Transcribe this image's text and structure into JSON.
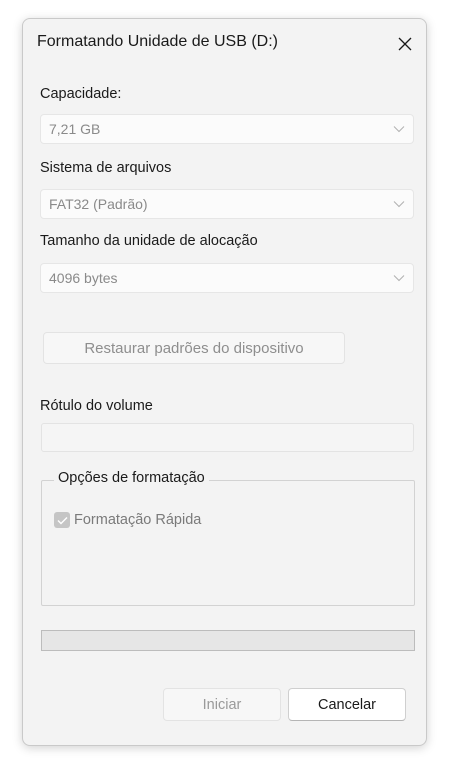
{
  "dialog": {
    "title": "Formatando Unidade de USB (D:)"
  },
  "capacity": {
    "label": "Capacidade:",
    "value": "7,21 GB"
  },
  "file_system": {
    "label": "Sistema de arquivos",
    "value": "FAT32 (Padrão)"
  },
  "allocation_unit": {
    "label": "Tamanho da unidade de alocação",
    "value": "4096 bytes"
  },
  "restore_defaults_label": "Restaurar padrões do dispositivo",
  "volume_label": {
    "label": "Rótulo do volume",
    "value": ""
  },
  "format_options": {
    "legend": "Opções de formatação",
    "quick_format_label": "Formatação Rápida",
    "quick_format_checked": true,
    "quick_format_enabled": false
  },
  "progress": {
    "value": 0
  },
  "buttons": {
    "start_label": "Iniciar",
    "start_enabled": false,
    "cancel_label": "Cancelar"
  },
  "colors": {
    "window_bg": "#f3f3f3",
    "disabled_text": "#8a8a8a",
    "progress_fill": "#06b025"
  },
  "icons": {
    "close": "close-icon",
    "dropdown": "chevron-down-icon",
    "checkmark": "checkmark-icon"
  }
}
